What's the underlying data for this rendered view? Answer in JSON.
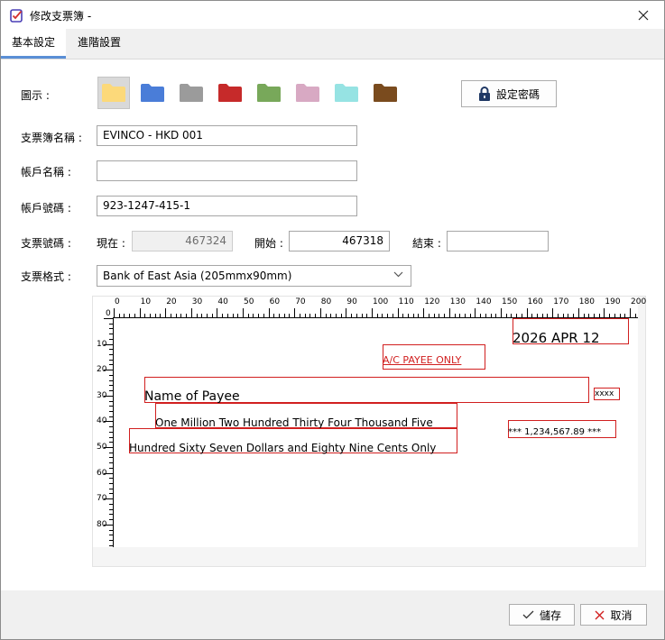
{
  "window": {
    "title": "修改支票簿 -"
  },
  "tabs": [
    {
      "label": "基本設定",
      "active": true
    },
    {
      "label": "進階設置",
      "active": false
    }
  ],
  "form": {
    "icon_label": "圖示 :",
    "folder_icons": [
      {
        "name": "folder-yellow-icon",
        "color": "#fcd97a",
        "selected": true
      },
      {
        "name": "folder-blue-icon",
        "color": "#4a7dd8",
        "selected": false
      },
      {
        "name": "folder-gray-icon",
        "color": "#9b9b9b",
        "selected": false
      },
      {
        "name": "folder-red-icon",
        "color": "#c62a2a",
        "selected": false
      },
      {
        "name": "folder-green-icon",
        "color": "#78a85a",
        "selected": false
      },
      {
        "name": "folder-pink-icon",
        "color": "#d8a9c3",
        "selected": false
      },
      {
        "name": "folder-cyan-icon",
        "color": "#96e3e3",
        "selected": false
      },
      {
        "name": "folder-brown-icon",
        "color": "#7a4b1e",
        "selected": false
      }
    ],
    "password_button": "設定密碼",
    "chequebook_name_label": "支票簿名稱 :",
    "chequebook_name_value": "EVINCO - HKD 001",
    "account_name_label": "帳戶名稱 :",
    "account_name_value": "",
    "account_number_label": "帳戶號碼 :",
    "account_number_value": "923-1247-415-1",
    "cheque_number_label": "支票號碼 :",
    "current_label": "現在 :",
    "current_value": "467324",
    "start_label": "開始 :",
    "start_value": "467318",
    "end_label": "結束 :",
    "end_value": "",
    "format_label": "支票格式 :",
    "format_value": "Bank of East Asia (205mmx90mm)"
  },
  "preview": {
    "hruler_labels": [
      "0",
      "10",
      "20",
      "30",
      "40",
      "50",
      "60",
      "70",
      "80",
      "90",
      "100",
      "110",
      "120",
      "130",
      "140",
      "150",
      "160",
      "170",
      "180",
      "190",
      "200"
    ],
    "vruler_labels": [
      "0",
      "10",
      "20",
      "30",
      "40",
      "50",
      "60",
      "70",
      "80"
    ],
    "date_text": "2026 APR 12",
    "crossing_text": "A/C PAYEE ONLY",
    "payee_text": "Name of Payee",
    "bearer_text": "xxxx",
    "amount_words_line1": "One Million Two Hundred Thirty Four Thousand Five",
    "amount_words_line2": "Hundred Sixty Seven Dollars and Eighty Nine Cents Only",
    "amount_figures": "*** 1,234,567.89 ***"
  },
  "footer": {
    "save_label": "儲存",
    "cancel_label": "取消"
  },
  "colors": {
    "accent": "#5a8fd6",
    "field_border": "#d11f1f",
    "crossing_text": "#d11f1f"
  }
}
